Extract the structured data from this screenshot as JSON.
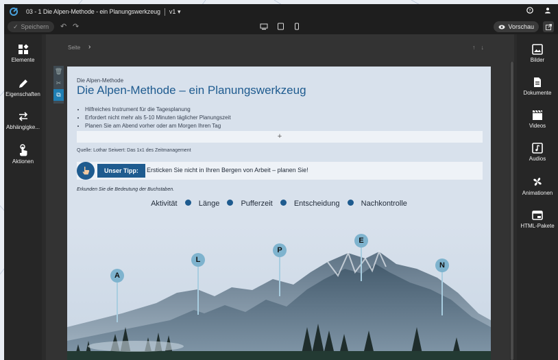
{
  "window": {
    "title": "03 - 1 Die Alpen-Methode - ein Planungswerkzeug",
    "version": "v1"
  },
  "toolbar": {
    "save_label": "Speichern",
    "preview_label": "Vorschau"
  },
  "left_sidebar": {
    "items": [
      {
        "label": "Elemente",
        "icon": "elements-icon"
      },
      {
        "label": "Eigenschaften",
        "icon": "pencil-icon"
      },
      {
        "label": "Abhängigke...",
        "icon": "swap-arrows-icon"
      },
      {
        "label": "Aktionen",
        "icon": "hand-pointer-icon"
      }
    ]
  },
  "right_sidebar": {
    "items": [
      {
        "label": "Bilder",
        "icon": "image-icon"
      },
      {
        "label": "Dokumente",
        "icon": "document-icon"
      },
      {
        "label": "Videos",
        "icon": "clapperboard-icon"
      },
      {
        "label": "Audios",
        "icon": "music-note-icon"
      },
      {
        "label": "Animationen",
        "icon": "pinwheel-icon"
      },
      {
        "label": "HTML-Pakete",
        "icon": "window-icon"
      }
    ]
  },
  "page_bar": {
    "label": "Seite"
  },
  "slide": {
    "subtitle": "Die Alpen-Methode",
    "title": "Die Alpen-Methode – ein Planungswerkzeug",
    "bullets": [
      "Hilfreiches Instrument für die Tagesplanung",
      "Erfordert nicht mehr als 5-10 Minuten täglicher Planungszeit",
      "Planen Sie am Abend vorher oder am Morgen Ihren Tag"
    ],
    "plus": "+",
    "source": "Quelle: Lothar Seiwert: Das 1x1 des Zeitmanagement",
    "tip_label": "Unser Tipp:",
    "tip_text": "Ersticken Sie nicht in Ihren Bergen von Arbeit – planen Sie!",
    "instruction": "Erkunden Sie die Bedeutung der Buchstaben.",
    "legend": [
      "Aktivität",
      "Länge",
      "Pufferzeit",
      "Entscheidung",
      "Nachkontrolle"
    ],
    "markers": [
      "A",
      "L",
      "P",
      "E",
      "N"
    ]
  },
  "colors": {
    "accent": "#1e5b8f",
    "marker": "#7eb3ce",
    "slide_bg": "#d8e1ec"
  }
}
